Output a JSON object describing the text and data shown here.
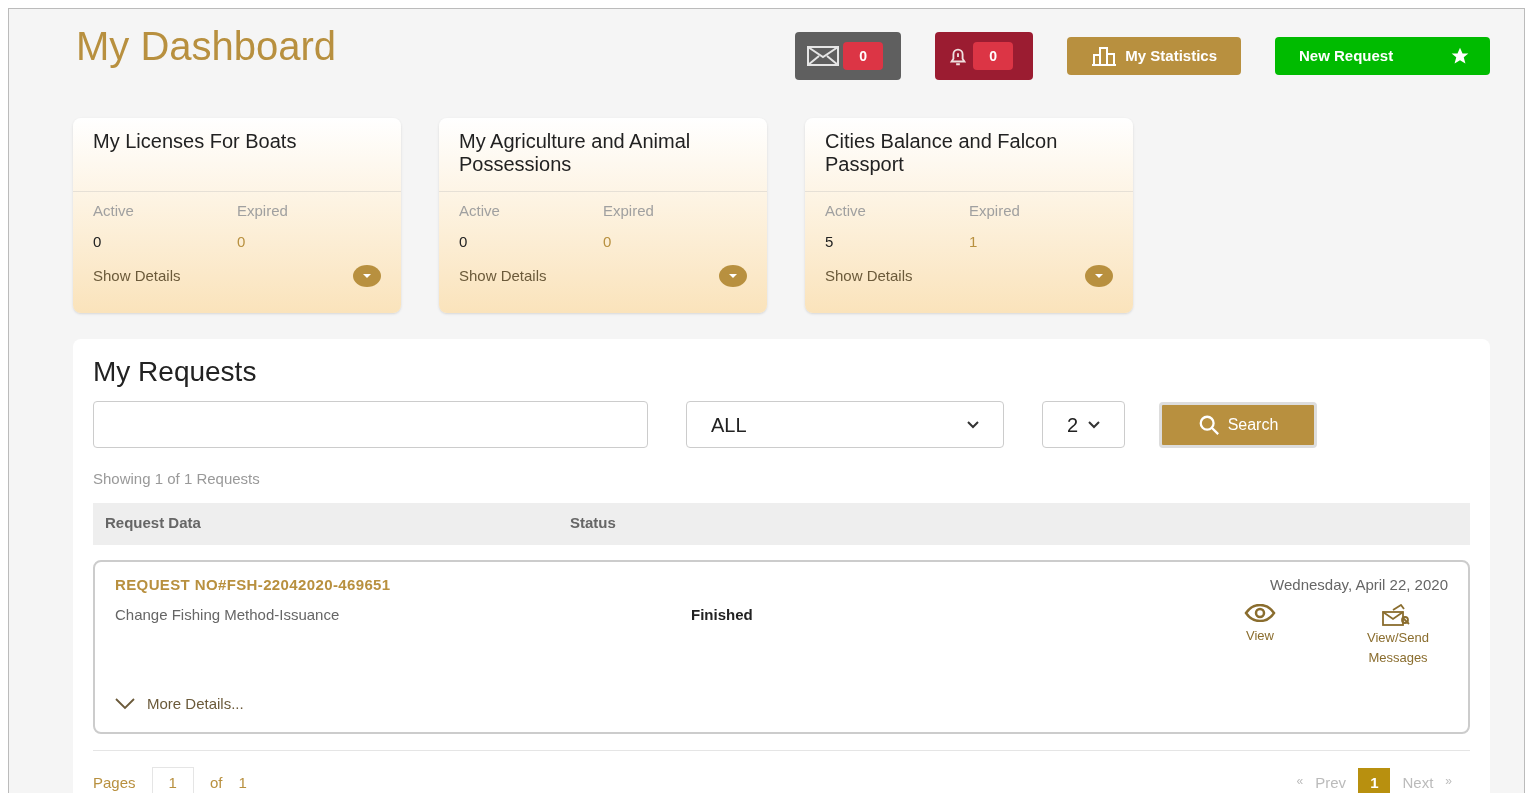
{
  "title": "My Dashboard",
  "header_actions": [
    {
      "kind": "mail",
      "count": "0"
    },
    {
      "kind": "alert",
      "count": "0"
    },
    {
      "kind": "stats",
      "label": "My Statistics"
    },
    {
      "kind": "new",
      "label": "New Request"
    }
  ],
  "cards": [
    {
      "title": "My Licenses For Boats",
      "active_label": "Active",
      "expired_label": "Expired",
      "active": "0",
      "expired": "0",
      "details": "Show Details"
    },
    {
      "title": "My Agriculture and Animal Possessions",
      "active_label": "Active",
      "expired_label": "Expired",
      "active": "0",
      "expired": "0",
      "details": "Show Details"
    },
    {
      "title": "Cities Balance and Falcon Passport",
      "active_label": "Active",
      "expired_label": "Expired",
      "active": "5",
      "expired": "1",
      "details": "Show Details"
    }
  ],
  "requests": {
    "title": "My Requests",
    "status_filter": "ALL",
    "page_size": "2",
    "search_button": "Search",
    "showing": "Showing 1 of 1 Requests",
    "columns": [
      "Request Data",
      "Status"
    ],
    "rows": [
      {
        "number": "REQUEST NO#FSH-22042020-469651",
        "service": "Change Fishing Method-Issuance",
        "status": "Finished",
        "date": "Wednesday, April 22, 2020",
        "view": "View",
        "messages": "View/Send Messages",
        "more": "More Details..."
      }
    ],
    "pager": {
      "pages_label": "Pages",
      "current": "1",
      "of_label": "of",
      "total": "1",
      "prev": "Prev",
      "next": "Next",
      "prev_mark": "«",
      "next_mark": "»",
      "pages": [
        {
          "label": "1",
          "selected": true
        }
      ]
    }
  }
}
